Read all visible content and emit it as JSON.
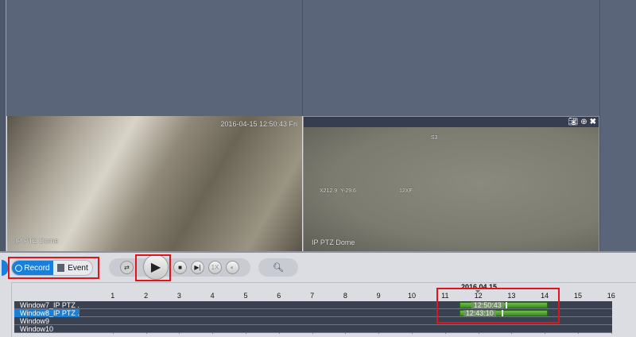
{
  "video_panels": [
    {
      "timestamp": "2016-04-15 12:50:43 Fri",
      "camera_name": "IP PTZ Dome"
    },
    {
      "camera_name": "IP PTZ Dome",
      "osd_top": "S3",
      "osd_coords": "X212.9  Y-29.6",
      "osd_zoom": "12XF",
      "toolbar_icons": [
        "camera-icon",
        "zoom-in-icon",
        "close-icon"
      ]
    }
  ],
  "mode_toggle": {
    "record_label": "Record",
    "event_label": "Event",
    "active": "Record"
  },
  "playback": {
    "speed_label": "1X"
  },
  "timeline": {
    "date": "2016.04.15",
    "hours": [
      "1",
      "2",
      "3",
      "4",
      "5",
      "6",
      "7",
      "8",
      "9",
      "10",
      "11",
      "12",
      "13",
      "14",
      "15",
      "16"
    ],
    "rows": [
      {
        "label": "Window7_IP PTZ ...",
        "time": "12:50:43",
        "selected": false
      },
      {
        "label": "Window8_IP PTZ ...",
        "time": "12:43:10",
        "selected": true
      },
      {
        "label": "Window9",
        "selected": false
      },
      {
        "label": "Window10",
        "selected": false
      }
    ]
  },
  "colors": {
    "accent": "#1a7fd8",
    "highlight": "#e0141c",
    "record": "#4ea62c"
  }
}
